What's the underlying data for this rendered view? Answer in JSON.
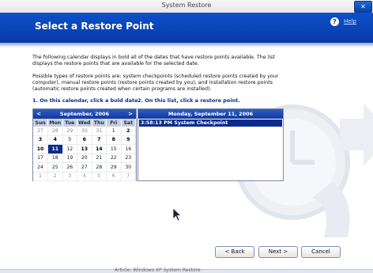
{
  "window": {
    "title": "System Restore"
  },
  "header": {
    "title": "Select a Restore Point",
    "help_label": "Help"
  },
  "intro": {
    "p1": "The following calendar displays in bold all of the dates that have restore points available. The list displays the restore points that are available for the selected date.",
    "p2": "Possible types of restore points are: system checkpoints (scheduled restore points created by your computer), manual restore points (restore points created by you), and installation restore points (automatic restore points created when certain programs are installed)."
  },
  "steps": {
    "step1": "1. On this calendar, click a bold date.",
    "step2": "2. On this list, click a restore point."
  },
  "calendar": {
    "month_label": "September, 2006",
    "prev": "<",
    "next": ">",
    "days": [
      "Sun",
      "Mon",
      "Tue",
      "Wed",
      "Thu",
      "Fri",
      "Sat"
    ],
    "weeks": [
      [
        {
          "d": "27",
          "t": "other"
        },
        {
          "d": "28",
          "t": "other"
        },
        {
          "d": "29",
          "t": "other"
        },
        {
          "d": "30",
          "t": "other"
        },
        {
          "d": "31",
          "t": "other"
        },
        {
          "d": "1",
          "t": "normal"
        },
        {
          "d": "2",
          "t": "bold"
        }
      ],
      [
        {
          "d": "3",
          "t": "bold"
        },
        {
          "d": "4",
          "t": "bold"
        },
        {
          "d": "5",
          "t": "normal"
        },
        {
          "d": "6",
          "t": "bold"
        },
        {
          "d": "7",
          "t": "bold"
        },
        {
          "d": "8",
          "t": "bold"
        },
        {
          "d": "9",
          "t": "bold"
        }
      ],
      [
        {
          "d": "10",
          "t": "bold"
        },
        {
          "d": "11",
          "t": "sel"
        },
        {
          "d": "12",
          "t": "normal"
        },
        {
          "d": "13",
          "t": "bold"
        },
        {
          "d": "14",
          "t": "bold"
        },
        {
          "d": "15",
          "t": "normal"
        },
        {
          "d": "16",
          "t": "normal"
        }
      ],
      [
        {
          "d": "17",
          "t": "normal"
        },
        {
          "d": "18",
          "t": "normal"
        },
        {
          "d": "19",
          "t": "normal"
        },
        {
          "d": "20",
          "t": "normal"
        },
        {
          "d": "21",
          "t": "normal"
        },
        {
          "d": "22",
          "t": "normal"
        },
        {
          "d": "23",
          "t": "normal"
        }
      ],
      [
        {
          "d": "24",
          "t": "normal"
        },
        {
          "d": "25",
          "t": "normal"
        },
        {
          "d": "26",
          "t": "normal"
        },
        {
          "d": "27",
          "t": "normal"
        },
        {
          "d": "28",
          "t": "normal"
        },
        {
          "d": "29",
          "t": "normal"
        },
        {
          "d": "30",
          "t": "normal"
        }
      ],
      [
        {
          "d": "1",
          "t": "other"
        },
        {
          "d": "2",
          "t": "other"
        },
        {
          "d": "3",
          "t": "other"
        },
        {
          "d": "4",
          "t": "other"
        },
        {
          "d": "5",
          "t": "other"
        },
        {
          "d": "6",
          "t": "other"
        },
        {
          "d": "7",
          "t": "other"
        }
      ]
    ]
  },
  "restore_list": {
    "date_label": "Monday, September 11, 2006",
    "items": [
      {
        "time": "3:58:13 PM",
        "name": "System Checkpoint"
      }
    ]
  },
  "buttons": {
    "back": "< Back",
    "next": "Next >",
    "cancel": "Cancel"
  },
  "footer_caption": "Article: Windows XP System Restore",
  "colors": {
    "header_blue": "#0a45b8",
    "selection": "#0a2b8a",
    "step_text": "#0a2a8a"
  }
}
